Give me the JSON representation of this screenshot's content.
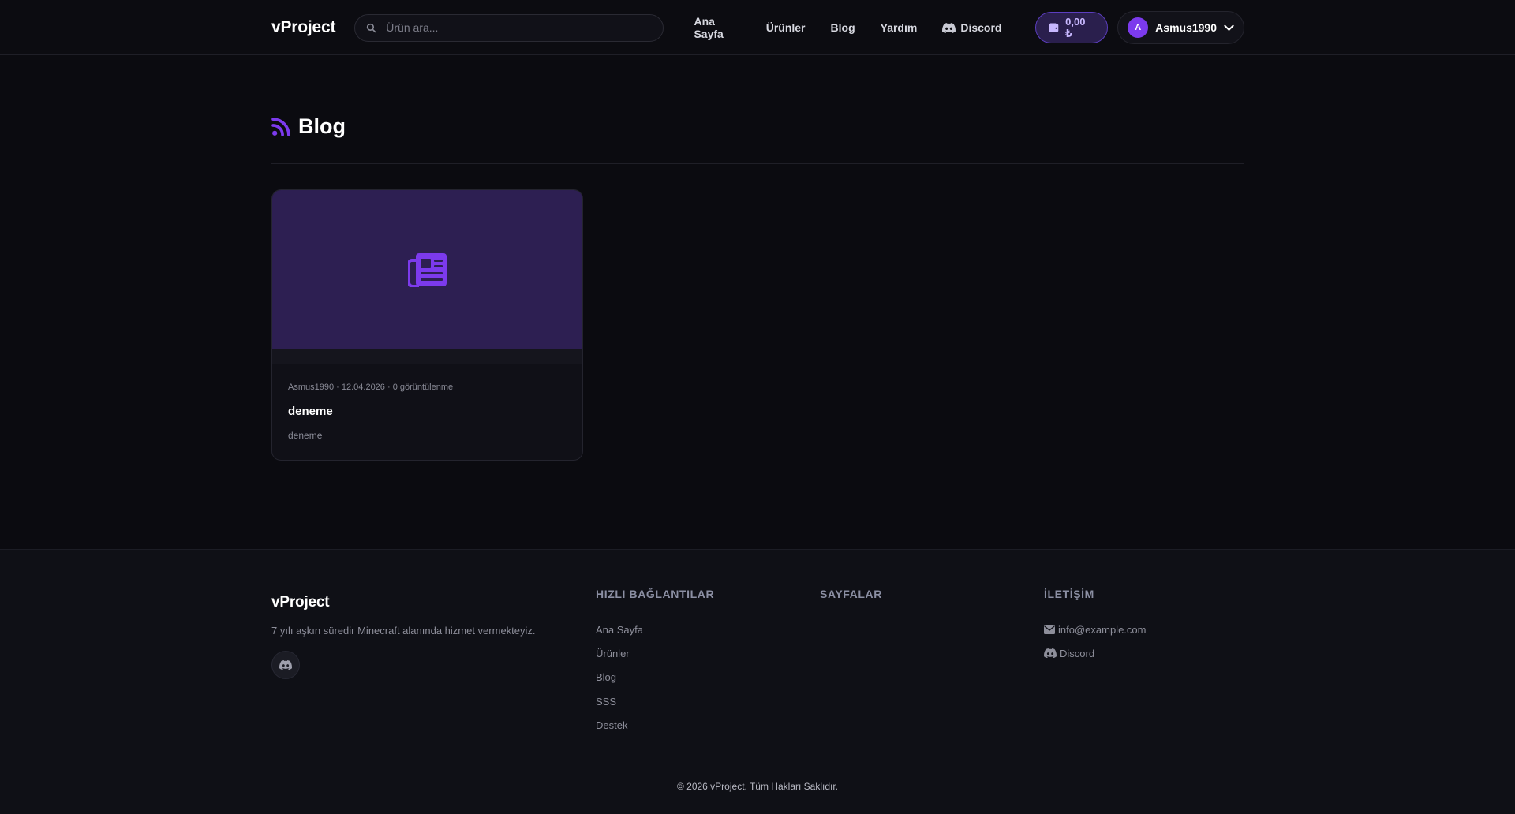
{
  "header": {
    "logo": "vProject",
    "search_placeholder": "Ürün ara...",
    "nav": {
      "home": "Ana Sayfa",
      "products": "Ürünler",
      "blog": "Blog",
      "help": "Yardım",
      "discord": "Discord"
    },
    "balance": "0,00 ₺",
    "user": {
      "initial": "A",
      "name": "Asmus1990"
    }
  },
  "main": {
    "title": "Blog",
    "posts": [
      {
        "meta": "Asmus1990 · 12.04.2026 · 0 görüntülenme",
        "title": "deneme",
        "excerpt": "deneme"
      }
    ]
  },
  "footer": {
    "logo": "vProject",
    "description": "7 yılı aşkın süredir Minecraft alanında hizmet vermekteyiz.",
    "quick_links": {
      "heading": "HIZLI BAĞLANTILAR",
      "items": [
        "Ana Sayfa",
        "Ürünler",
        "Blog",
        "SSS",
        "Destek"
      ]
    },
    "pages": {
      "heading": "SAYFALAR"
    },
    "contact": {
      "heading": "İLETİŞİM",
      "email": "info@example.com",
      "discord": "Discord"
    },
    "copyright": "© 2026 vProject. Tüm Hakları Saklıdır."
  },
  "colors": {
    "accent": "#7c3aed",
    "background": "#0b0b10",
    "card_thumb": "#2d1f52"
  },
  "icons": {
    "search": "search-icon",
    "discord": "discord-icon",
    "wallet": "wallet-icon",
    "chevron": "chevron-down-icon",
    "rss": "rss-icon",
    "newspaper": "newspaper-icon",
    "envelope": "envelope-icon"
  }
}
